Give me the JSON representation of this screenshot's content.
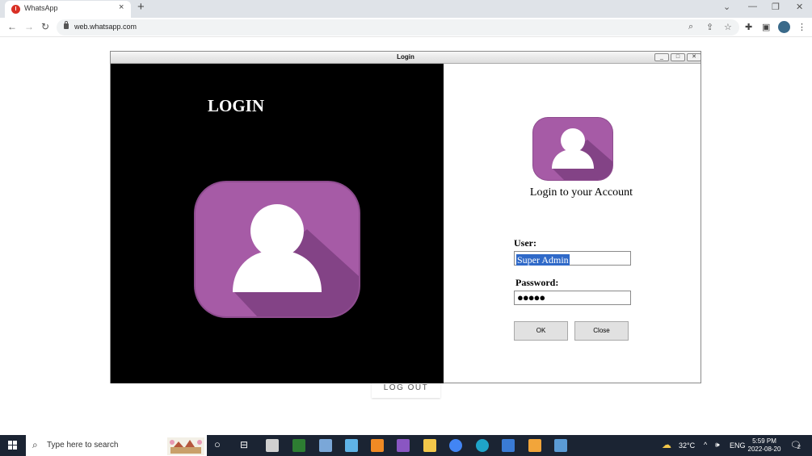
{
  "browser": {
    "tab_title": "WhatsApp",
    "tab_close": "×",
    "new_tab": "+",
    "url": "web.whatsapp.com"
  },
  "page": {
    "logout_label": "LOG OUT"
  },
  "dialog": {
    "title": "Login",
    "heading": "LOGIN",
    "account_text": "Login to your Account",
    "user_label": "User:",
    "user_value": "Super Admin",
    "password_label": "Password:",
    "password_value": "●●●●●",
    "ok_label": "OK",
    "close_label": "Close"
  },
  "taskbar": {
    "search_placeholder": "Type here to search",
    "temperature": "32°C",
    "language": "ENG",
    "time": "5:59 PM",
    "date": "2022-08-20",
    "notification_count": "2"
  },
  "colors": {
    "avatar_purple": "#a65ba6",
    "avatar_shadow": "#7d3f80",
    "dialog_left_panel": "#000000",
    "selection_blue": "#2f69c8",
    "taskbar": "#1b2433"
  },
  "icons": [
    "back-icon",
    "forward-icon",
    "reload-icon",
    "lock-icon",
    "zoom-icon",
    "share-icon",
    "star-icon",
    "extensions-icon",
    "sidepanel-icon",
    "profile-icon",
    "menu-icon",
    "user-avatar-icon",
    "windows-start-icon",
    "search-icon",
    "cortana-icon",
    "task-view-icon",
    "weather-icon",
    "notification-icon"
  ]
}
